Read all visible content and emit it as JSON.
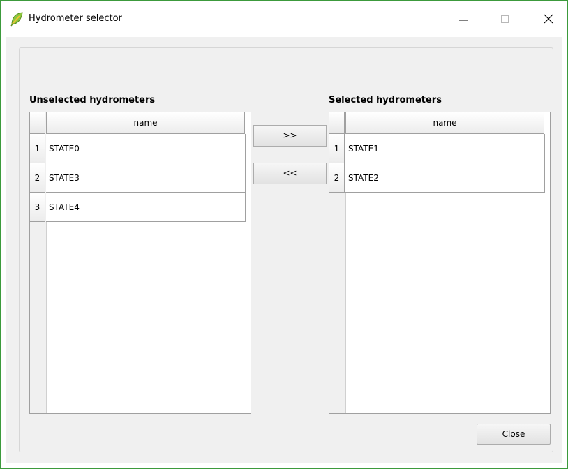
{
  "window": {
    "title": "Hydrometer selector",
    "icon": "qgis-leaf-icon"
  },
  "controls": {
    "minimize": "—",
    "maximize": "☐",
    "close": "✕"
  },
  "unselected": {
    "label": "Unselected hydrometers",
    "column_header": "name",
    "rows": [
      {
        "num": "1",
        "name": "STATE0"
      },
      {
        "num": "2",
        "name": "STATE3"
      },
      {
        "num": "3",
        "name": "STATE4"
      }
    ]
  },
  "selected": {
    "label": "Selected hydrometers",
    "column_header": "name",
    "rows": [
      {
        "num": "1",
        "name": "STATE1"
      },
      {
        "num": "2",
        "name": "STATE2"
      }
    ]
  },
  "buttons": {
    "add": ">>",
    "remove": "<<",
    "close": "Close"
  },
  "colors": {
    "window_border": "#3c9a3c",
    "client_bg": "#f0f0f0"
  }
}
